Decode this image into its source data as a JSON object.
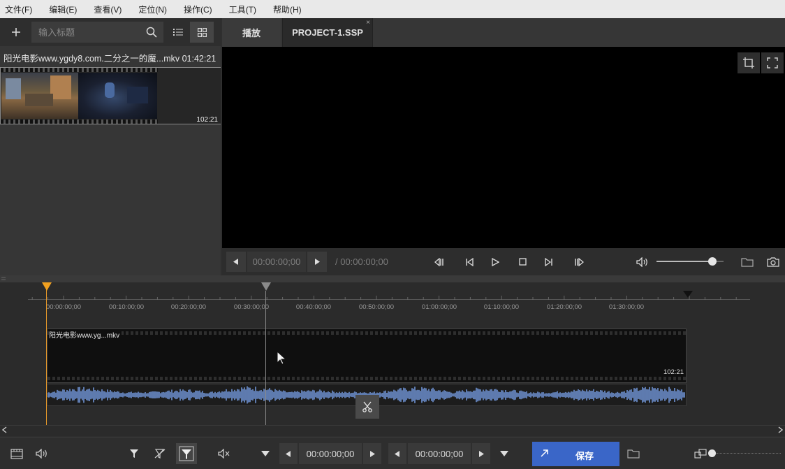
{
  "menu": [
    "文件(F)",
    "编辑(E)",
    "查看(V)",
    "定位(N)",
    "操作(C)",
    "工具(T)",
    "帮助(H)"
  ],
  "media_panel": {
    "search_placeholder": "输入标题",
    "item": {
      "title": "阳光电影www.ygdy8.com.二分之一的魔...mkv 01:42:21",
      "duration": "102:21"
    }
  },
  "player": {
    "tabs": [
      {
        "label": "播放"
      },
      {
        "label": "PROJECT-1.SSP"
      }
    ],
    "tab_close_glyph": "×",
    "current_timecode": "00:00:00;00",
    "total_timecode": "/ 00:00:00;00",
    "volume_fraction": 0.83
  },
  "timeline": {
    "ticks": [
      "00:00:00;00",
      "00:10:00;00",
      "00:20:00;00",
      "00:30:00;00",
      "00:40:00;00",
      "00:50:00;00",
      "01:00:00;00",
      "01:10:00;00",
      "01:20:00;00",
      "01:30:00;00"
    ],
    "clip_name": "阳光电影www.yg...mkv",
    "clip_duration": "102:21"
  },
  "bottom": {
    "in_timecode": "00:00:00;00",
    "out_timecode": "00:00:00;00",
    "save_label": "保存"
  },
  "colors": {
    "accent_blue": "#3a66c8",
    "waveform": "#6f93d4",
    "start_marker": "#f0a020"
  }
}
